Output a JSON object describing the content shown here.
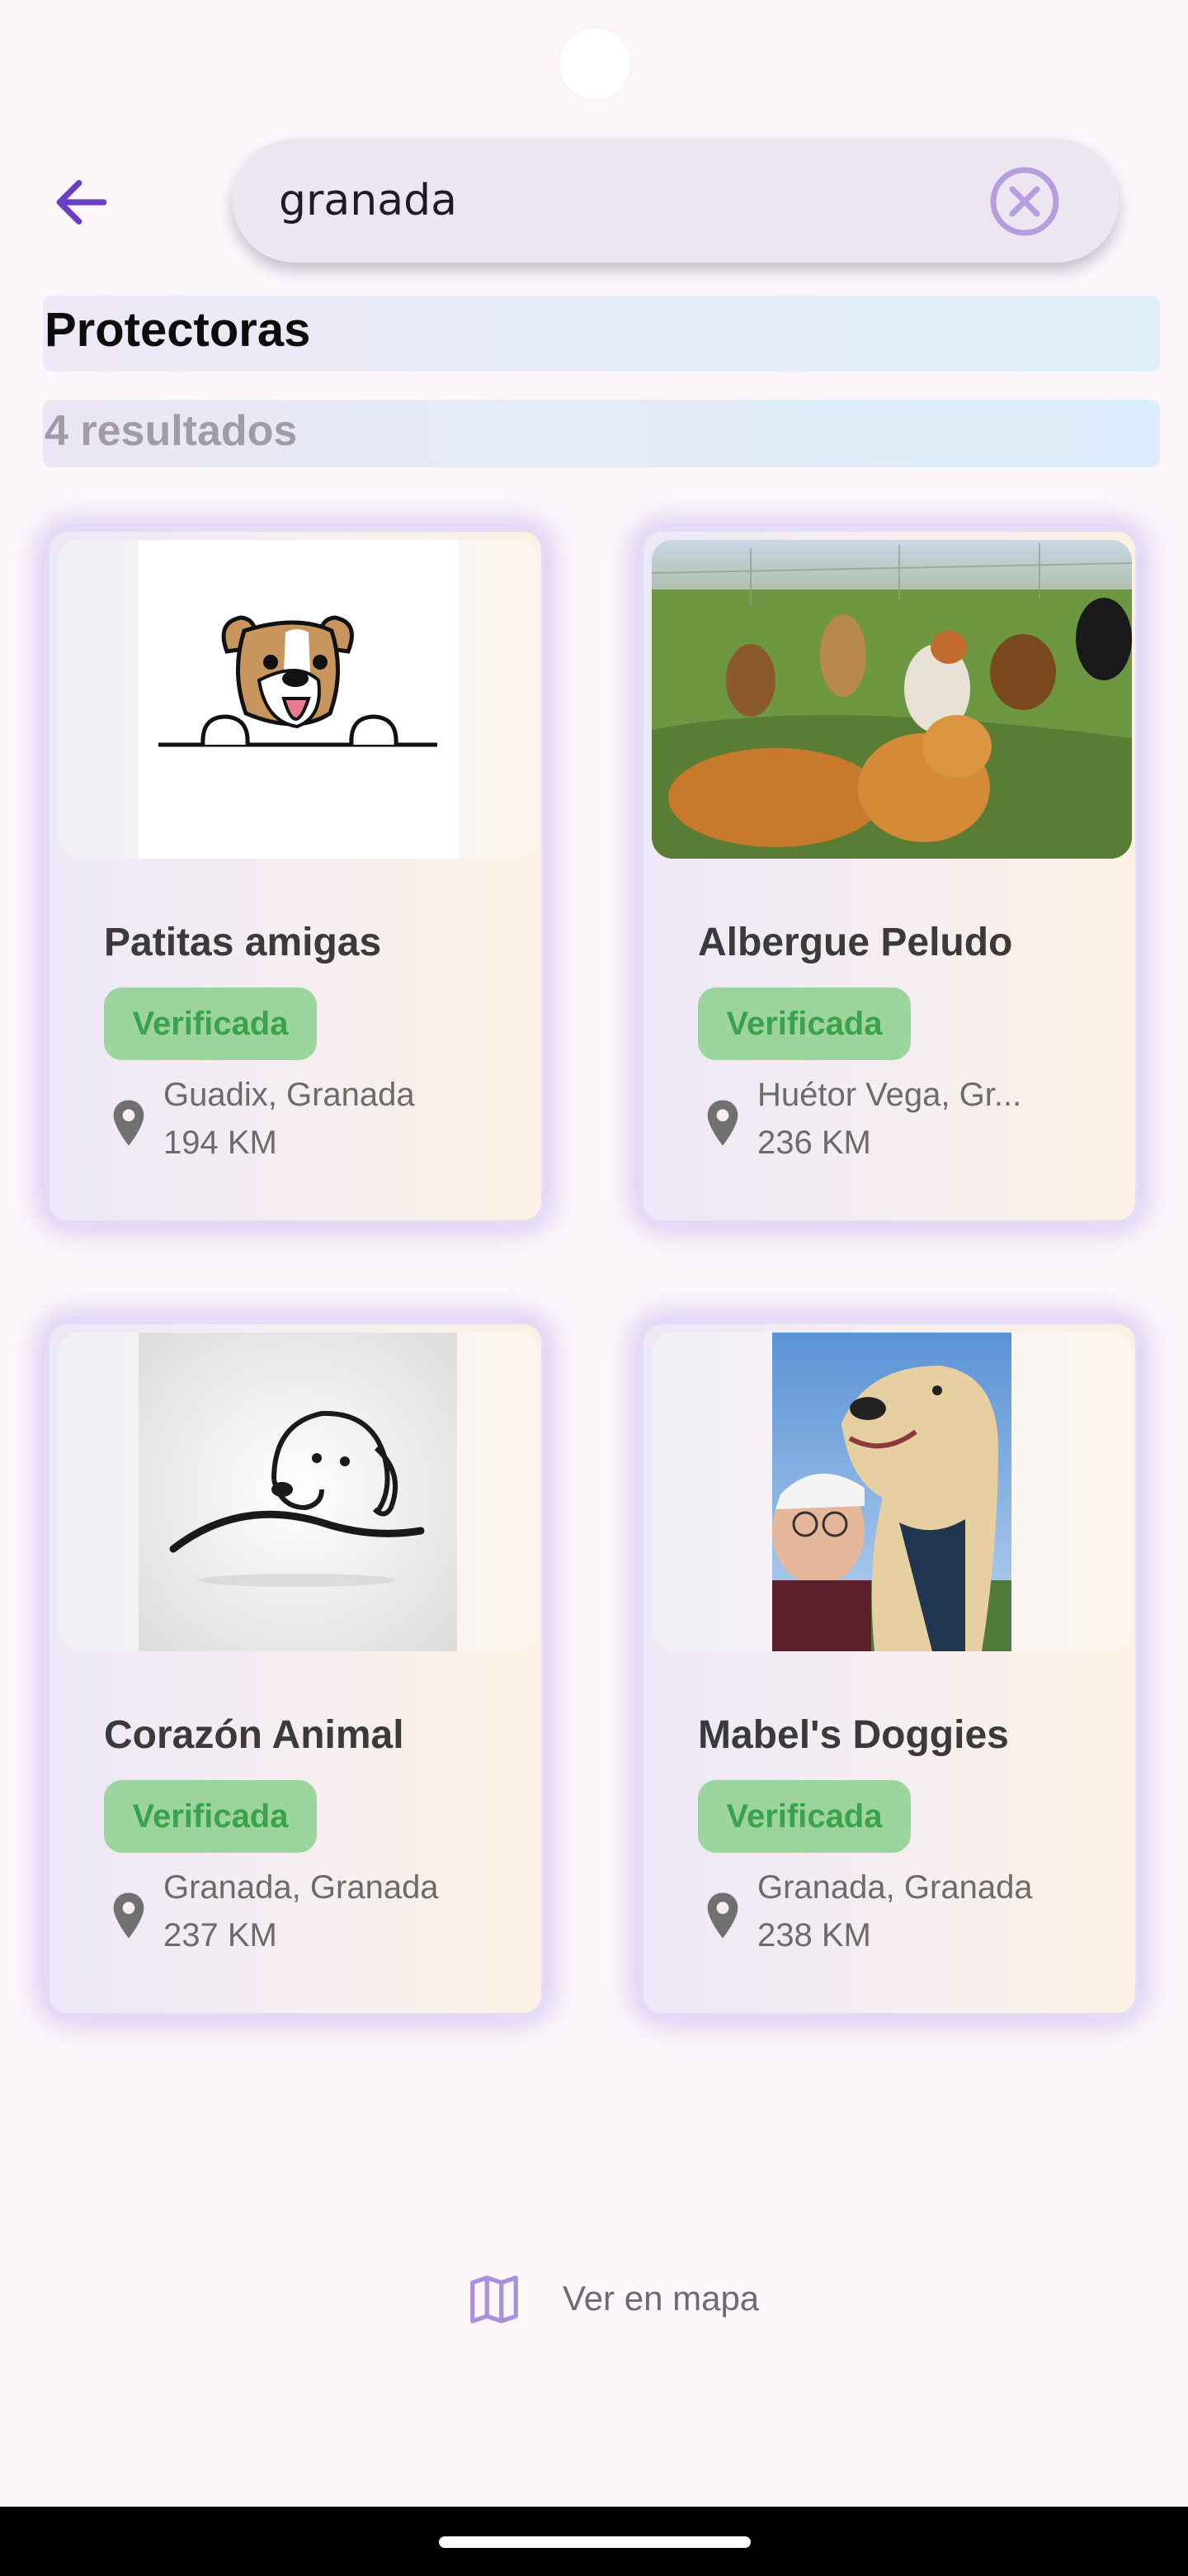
{
  "search": {
    "value": "granada"
  },
  "section": {
    "title": "Protectoras",
    "count": "4 resultados"
  },
  "cards": [
    {
      "name": "Patitas amigas",
      "badge": "Verificada",
      "city": "Guadix, Granada",
      "distance": "194 KM",
      "image": "cartoon-dog-logo"
    },
    {
      "name": "Albergue Peludo",
      "badge": "Verificada",
      "city": "Huétor Vega, Gr...",
      "distance": "236 KM",
      "image": "dogs-on-grass-photo"
    },
    {
      "name": "Corazón Animal",
      "badge": "Verificada",
      "city": "Granada, Granada",
      "distance": "237 KM",
      "image": "dog-line-art-logo"
    },
    {
      "name": "Mabel's Doggies",
      "badge": "Verificada",
      "city": "Granada, Granada",
      "distance": "238 KM",
      "image": "dog-selfie-photo"
    }
  ],
  "map_button": {
    "label": "Ver en mapa",
    "icon": "map-icon"
  },
  "colors": {
    "accent": "#6a3fc2",
    "badge_bg": "#9cd49d",
    "badge_text": "#3aa24a",
    "clear_icon": "#b79ce0"
  }
}
